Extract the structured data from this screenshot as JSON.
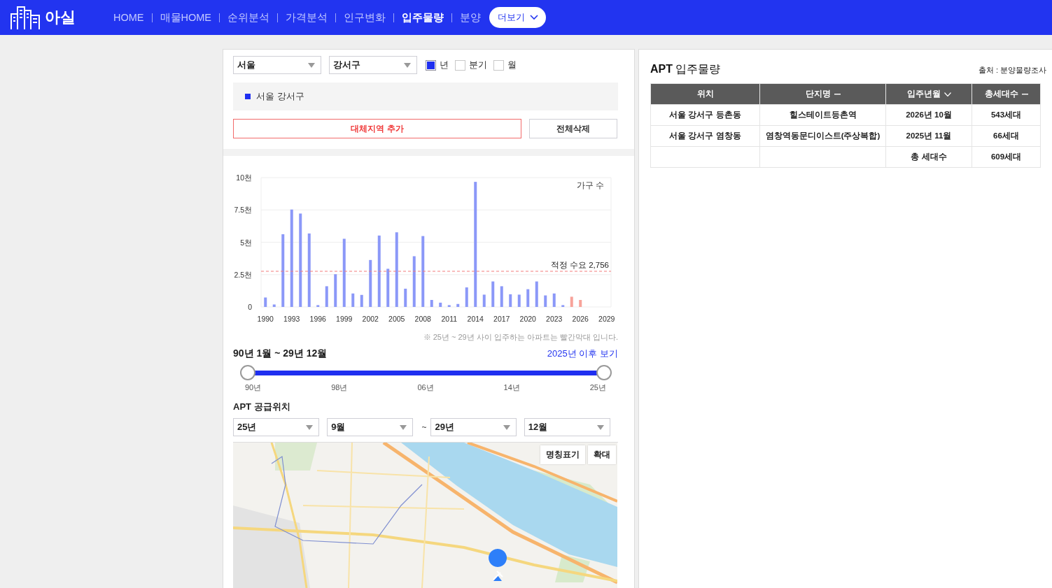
{
  "header": {
    "logo_text": "아실",
    "nav": [
      {
        "label": "HOME",
        "selected": false
      },
      {
        "label": "매물HOME",
        "selected": false
      },
      {
        "label": "순위분석",
        "selected": false
      },
      {
        "label": "가격분석",
        "selected": false
      },
      {
        "label": "인구변화",
        "selected": false
      },
      {
        "label": "입주물량",
        "selected": true
      },
      {
        "label": "분양",
        "selected": false
      }
    ],
    "more_button": "더보기"
  },
  "filters": {
    "region": "서울",
    "district": "강서구",
    "periods": [
      {
        "label": "년",
        "checked": true
      },
      {
        "label": "분기",
        "checked": false
      },
      {
        "label": "월",
        "checked": false
      }
    ]
  },
  "regions": [
    {
      "label": "서울 강서구",
      "color": "#1f2ff0"
    }
  ],
  "buttons": {
    "add": "대체지역 추가",
    "clear": "전체삭제"
  },
  "chart": {
    "chart_data": {
      "type": "bar",
      "ylabel": "가구 수",
      "x": [
        1990,
        1991,
        1992,
        1993,
        1994,
        1995,
        1996,
        1997,
        1998,
        1999,
        2000,
        2001,
        2002,
        2003,
        2004,
        2005,
        2006,
        2007,
        2008,
        2009,
        2010,
        2011,
        2012,
        2013,
        2014,
        2015,
        2016,
        2017,
        2018,
        2019,
        2020,
        2021,
        2022,
        2023,
        2024,
        2025,
        2026
      ],
      "series": [
        {
          "color": "#8b98f8",
          "values": [
            0.73,
            0.19,
            5.62,
            7.53,
            7.22,
            5.68,
            0.14,
            1.6,
            2.53,
            5.27,
            1.04,
            0.93,
            3.63,
            5.52,
            2.95,
            5.77,
            1.41,
            3.92,
            5.48,
            0.54,
            0.33,
            0.14,
            0.23,
            1.51,
            9.67,
            0.95,
            1.97,
            1.6,
            0.98,
            0.95,
            1.37,
            1.97,
            0.89,
            1.04,
            0.14,
            null,
            null
          ]
        },
        {
          "color": "#f7a39a",
          "values": [
            null,
            null,
            null,
            null,
            null,
            null,
            null,
            null,
            null,
            null,
            null,
            null,
            null,
            null,
            null,
            null,
            null,
            null,
            null,
            null,
            null,
            null,
            null,
            null,
            null,
            null,
            null,
            null,
            null,
            null,
            null,
            null,
            null,
            null,
            null,
            0.79,
            0.54
          ]
        }
      ],
      "xlim": [
        1989.5,
        2029.5
      ],
      "ylim": [
        0,
        10
      ],
      "xticks": [
        1990,
        1993,
        1996,
        1999,
        2002,
        2005,
        2008,
        2011,
        2014,
        2017,
        2020,
        2023,
        2026,
        2029
      ],
      "yticks": [
        0,
        {
          "value": 2.5,
          "label": "2.5천"
        },
        {
          "value": 5,
          "label": "5천"
        },
        {
          "value": 7.5,
          "label": "7.5천"
        },
        {
          "value": 10,
          "label": "10천"
        }
      ],
      "grid": true,
      "ref_lines": [
        {
          "axis": "y",
          "value": 2.756,
          "label": "적정 수요 2,756"
        }
      ]
    },
    "note": "※ 25년 ~ 29년 사이 입주하는 아파트는 빨간막대 입니다."
  },
  "range": {
    "label": "90년 1월 ~ 29년 12월",
    "link": "2025년 이후 보기",
    "thumbs": [
      {
        "level": 0
      },
      {
        "level": 1
      }
    ],
    "ticks": [
      "90년",
      "98년",
      "06년",
      "14년",
      "25년"
    ]
  },
  "supply": {
    "title": "APT 공급위치",
    "from_year": "25년",
    "from_month": "9월",
    "separator": "~",
    "to_year": "29년",
    "to_month": "12월",
    "map_buttons": [
      "명칭표기",
      "확대"
    ]
  },
  "table": {
    "title": "**APT** 입주물량",
    "source": "출처 : 분양물량조사",
    "columns": [
      {
        "label": "위치"
      },
      {
        "label": "단지명",
        "sorted": false
      },
      {
        "label": "입주년월",
        "sorted": true
      },
      {
        "label": "총세대수",
        "sorted": false
      }
    ],
    "rows": [
      [
        "서울 강서구 등촌동",
        "힐스테이트등촌역",
        "2026년 10월",
        "543세대"
      ],
      [
        "서울 강서구 염창동",
        "염창역동문디이스트(주상복합)",
        "2025년 11월",
        "66세대"
      ]
    ],
    "total": {
      "label": "총 세대수",
      "value": "609세대"
    }
  }
}
